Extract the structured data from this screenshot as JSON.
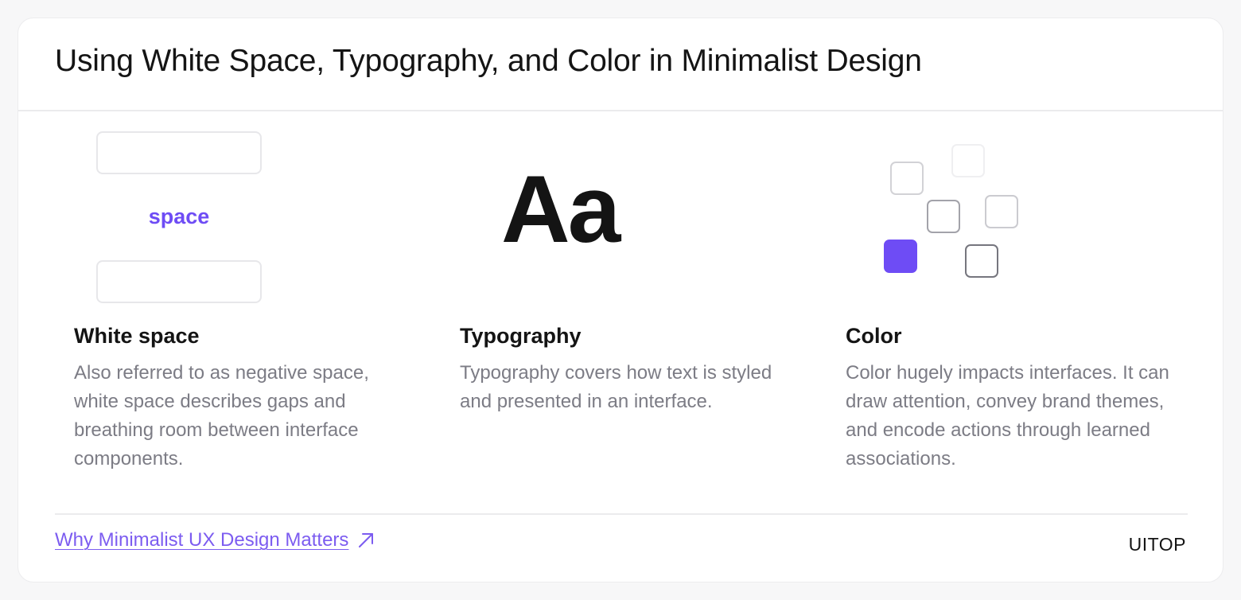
{
  "card": {
    "title": "Using White Space, Typography, and Color in Minimalist Design"
  },
  "columns": [
    {
      "title": "White space",
      "illustration_word": "space",
      "description": "Also referred to as negative space, white space describes gaps and breathing room between interface components."
    },
    {
      "title": "Typography",
      "illustration_glyphs": "Aa",
      "description": "Typography covers how text is styled and presented in an interface."
    },
    {
      "title": "Color",
      "description": "Color hugely impacts interfaces. It can draw attention, convey brand themes, and encode actions through learned associations."
    }
  ],
  "footer": {
    "link_label": "Why Minimalist UX Design Matters",
    "link_icon": "arrow-up-right-icon",
    "brand": "UITOP"
  },
  "colors": {
    "accent": "#6e4cf5",
    "text": "#141414",
    "muted_text": "#7c7c85"
  }
}
